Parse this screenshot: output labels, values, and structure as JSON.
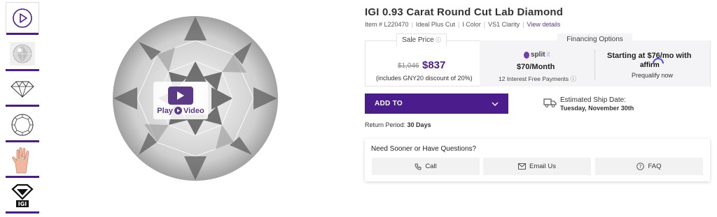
{
  "thumbnails": [
    {
      "name": "video-thumb",
      "icon": "play-icon"
    },
    {
      "name": "diamond-photo-thumb",
      "icon": "diamond-photo"
    },
    {
      "name": "diamond-side-thumb",
      "icon": "diamond-side-icon"
    },
    {
      "name": "diamond-top-thumb",
      "icon": "diamond-top-icon"
    },
    {
      "name": "hand-thumb",
      "icon": "hand-icon"
    },
    {
      "name": "igi-cert-thumb",
      "icon": "igi-icon"
    }
  ],
  "media": {
    "play_label": "Play",
    "video_label": "Video"
  },
  "product": {
    "title": "IGI 0.93 Carat Round Cut Lab Diamond",
    "item": "Item # L220470",
    "cut": "Ideal Plus Cut",
    "color": "I Color",
    "clarity": "VS1 Clarity",
    "view_details": "View details"
  },
  "pricing": {
    "sale_label": "Sale Price",
    "old_price": "$1,046",
    "price": "$837",
    "discount_note": "(includes GNY20 discount of 20%)"
  },
  "financing": {
    "label": "Financing Options",
    "splitit_brand": "split",
    "splitit_suffix": "it",
    "per_month": "$70/Month",
    "interest_note": "12 Interest Free Payments",
    "affirm_start": "Starting at $76/mo with",
    "affirm_brand": "affirm",
    "prequalify": "Prequalify now"
  },
  "actions": {
    "add_to": "ADD TO"
  },
  "shipping": {
    "label": "Estimated Ship Date:",
    "date": "Tuesday, November 30th"
  },
  "returns": {
    "label": "Return Period:",
    "value": "30 Days"
  },
  "help": {
    "title": "Need Sooner or Have Questions?",
    "call": "Call",
    "email": "Email Us",
    "faq": "FAQ"
  },
  "colors": {
    "brand_purple": "#4b1d8c",
    "panel_gray": "#f4f4f6"
  }
}
